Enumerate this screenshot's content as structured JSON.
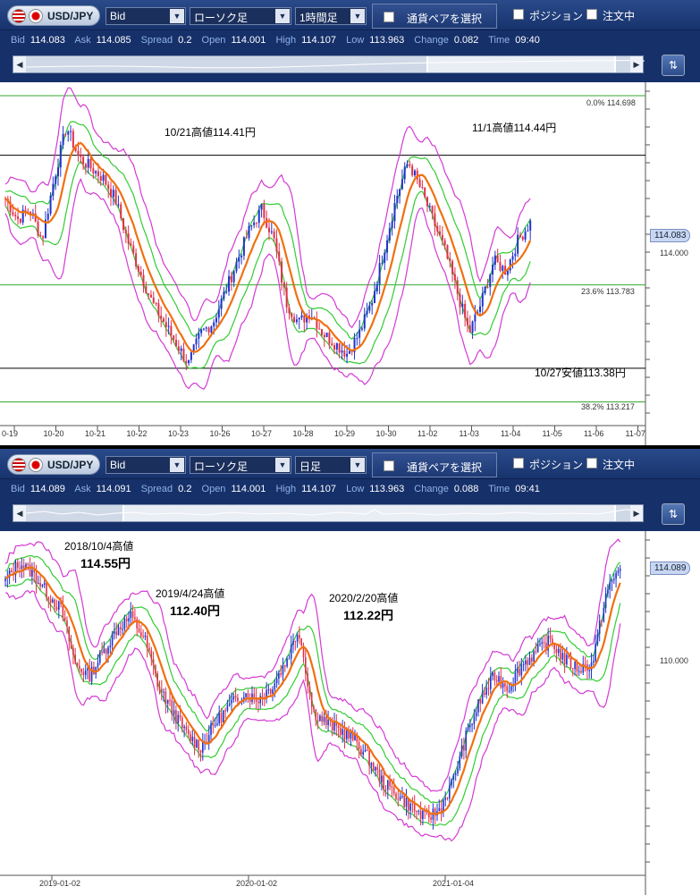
{
  "panels": [
    {
      "pair": "USD/JPY",
      "price_type": "Bid",
      "chart_type": "ローソク足",
      "timeframe": "1時間足",
      "pair_select": "通貨ペアを選択",
      "position": "ポジション",
      "orders": "注文中",
      "quote": {
        "bid_k": "Bid",
        "bid": "114.083",
        "ask_k": "Ask",
        "ask": "114.085",
        "spread_k": "Spread",
        "spread": "0.2",
        "open_k": "Open",
        "open": "114.001",
        "high_k": "High",
        "high": "114.107",
        "low_k": "Low",
        "low": "113.963",
        "change_k": "Change",
        "change": "0.082",
        "time_k": "Time",
        "time": "09:40"
      },
      "annotations": [
        "10/21高値114.41円",
        "11/1高値114.44円",
        "10/27安値113.38円"
      ],
      "fib": [
        {
          "label": "0.0%",
          "value": "114.698"
        },
        {
          "label": "23.6%",
          "value": "113.783"
        },
        {
          "label": "38.2%",
          "value": "113.217"
        }
      ],
      "price_labels": [
        "114.000"
      ],
      "current_price": "114.083",
      "x_labels": [
        "0-19",
        "10-20",
        "10-21",
        "10-22",
        "10-23",
        "10-26",
        "10-27",
        "10-28",
        "10-29",
        "10-30",
        "11-02",
        "11-03",
        "11-04",
        "11-05",
        "11-06",
        "11-07"
      ],
      "chart_data": {
        "type": "candlestick",
        "ylim": [
          113.15,
          114.75
        ],
        "levels": [
          114.698,
          114.41,
          113.783,
          113.38,
          113.217
        ],
        "close_path": [
          114.2,
          114.1,
          114.15,
          114.0,
          114.3,
          114.55,
          114.4,
          114.35,
          114.3,
          114.2,
          114.0,
          113.85,
          113.7,
          113.6,
          113.5,
          113.4,
          113.55,
          113.6,
          113.75,
          113.9,
          114.05,
          114.15,
          114.0,
          113.7,
          113.6,
          113.65,
          113.55,
          113.5,
          113.45,
          113.55,
          113.7,
          113.95,
          114.2,
          114.38,
          114.25,
          114.1,
          113.95,
          113.75,
          113.55,
          113.7,
          113.9,
          113.85,
          114.0,
          114.083
        ]
      }
    },
    {
      "pair": "USD/JPY",
      "price_type": "Bid",
      "chart_type": "ローソク足",
      "timeframe": "日足",
      "pair_select": "通貨ペアを選択",
      "position": "ポジション",
      "orders": "注文中",
      "quote": {
        "bid_k": "Bid",
        "bid": "114.089",
        "ask_k": "Ask",
        "ask": "114.091",
        "spread_k": "Spread",
        "spread": "0.2",
        "open_k": "Open",
        "open": "114.001",
        "high_k": "High",
        "high": "114.107",
        "low_k": "Low",
        "low": "113.963",
        "change_k": "Change",
        "change": "0.088",
        "time_k": "Time",
        "time": "09:41"
      },
      "annotations": [
        {
          "date": "2018/10/4高値",
          "price": "114.55円"
        },
        {
          "date": "2019/4/24高値",
          "price": "112.40円"
        },
        {
          "date": "2020/2/20高値",
          "price": "112.22円"
        }
      ],
      "price_labels": [
        "110.000"
      ],
      "current_price": "114.089",
      "x_labels": [
        "2019-01-02",
        "2020-01-02",
        "2021-01-04"
      ],
      "chart_data": {
        "type": "candlestick",
        "ylim": [
          101.5,
          115.5
        ],
        "close_path": [
          113.5,
          114.3,
          113.8,
          113.0,
          112.3,
          110.0,
          109.5,
          110.5,
          111.5,
          112.0,
          111.0,
          109.0,
          108.0,
          107.0,
          106.5,
          107.5,
          108.2,
          108.8,
          108.5,
          109.0,
          110.0,
          111.5,
          108.0,
          107.5,
          107.2,
          106.8,
          106.0,
          105.0,
          104.5,
          104.0,
          103.5,
          103.8,
          105.0,
          107.0,
          108.5,
          109.5,
          109.0,
          110.0,
          110.5,
          111.0,
          110.2,
          109.8,
          110.0,
          113.0,
          114.089
        ]
      }
    }
  ]
}
